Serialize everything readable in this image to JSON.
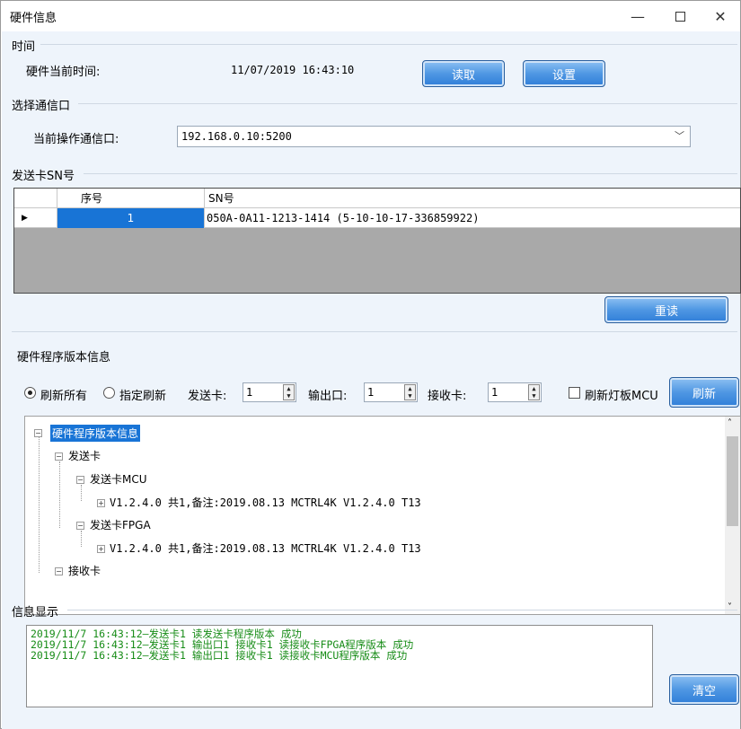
{
  "window": {
    "title": "硬件信息",
    "min_icon": "minimize-icon",
    "max_icon": "maximize-icon",
    "close_icon": "close-icon"
  },
  "time_group": {
    "legend": "时间",
    "label": "硬件当前时间:",
    "value": "11/07/2019 16:43:10",
    "read_button": "读取",
    "set_button": "设置"
  },
  "port_group": {
    "legend": "选择通信口",
    "label": "当前操作通信口:",
    "selected": "192.168.0.10:5200"
  },
  "sn_group": {
    "legend": "发送卡SN号",
    "columns": [
      "序号",
      "SN号"
    ],
    "rows": [
      {
        "index": "1",
        "sn": "050A-0A11-1213-1414  (5-10-10-17-336859922)"
      }
    ],
    "reread_button": "重读"
  },
  "version_group": {
    "legend": "硬件程序版本信息",
    "refresh_all": "刷新所有",
    "refresh_selected": "指定刷新",
    "send_card_label": "发送卡:",
    "send_card_value": "1",
    "output_label": "输出口:",
    "output_value": "1",
    "recv_card_label": "接收卡:",
    "recv_card_value": "1",
    "mcu_check_label": "刷新灯板MCU",
    "refresh_button": "刷新",
    "tree": {
      "root": "硬件程序版本信息",
      "send_card": "发送卡",
      "send_mcu": "发送卡MCU",
      "send_mcu_version": "V1.2.4.0 共1,备注:2019.08.13 MCTRL4K V1.2.4.0 T13",
      "send_fpga": "发送卡FPGA",
      "send_fpga_version": "V1.2.4.0 共1,备注:2019.08.13 MCTRL4K V1.2.4.0 T13",
      "recv_card": "接收卡"
    }
  },
  "info_group": {
    "legend": "信息显示",
    "log": "2019/11/7 16:43:12—发送卡1 读发送卡程序版本 成功\n2019/11/7 16:43:12—发送卡1 输出口1 接收卡1 读接收卡FPGA程序版本 成功\n2019/11/7 16:43:12—发送卡1 输出口1 接收卡1 读接收卡MCU程序版本 成功",
    "clear_button": "清空"
  },
  "colors": {
    "accent": "#3a88dc",
    "selected_cell": "#1874d6",
    "log_text": "#178c17",
    "client_bg": "#eef4fb"
  }
}
